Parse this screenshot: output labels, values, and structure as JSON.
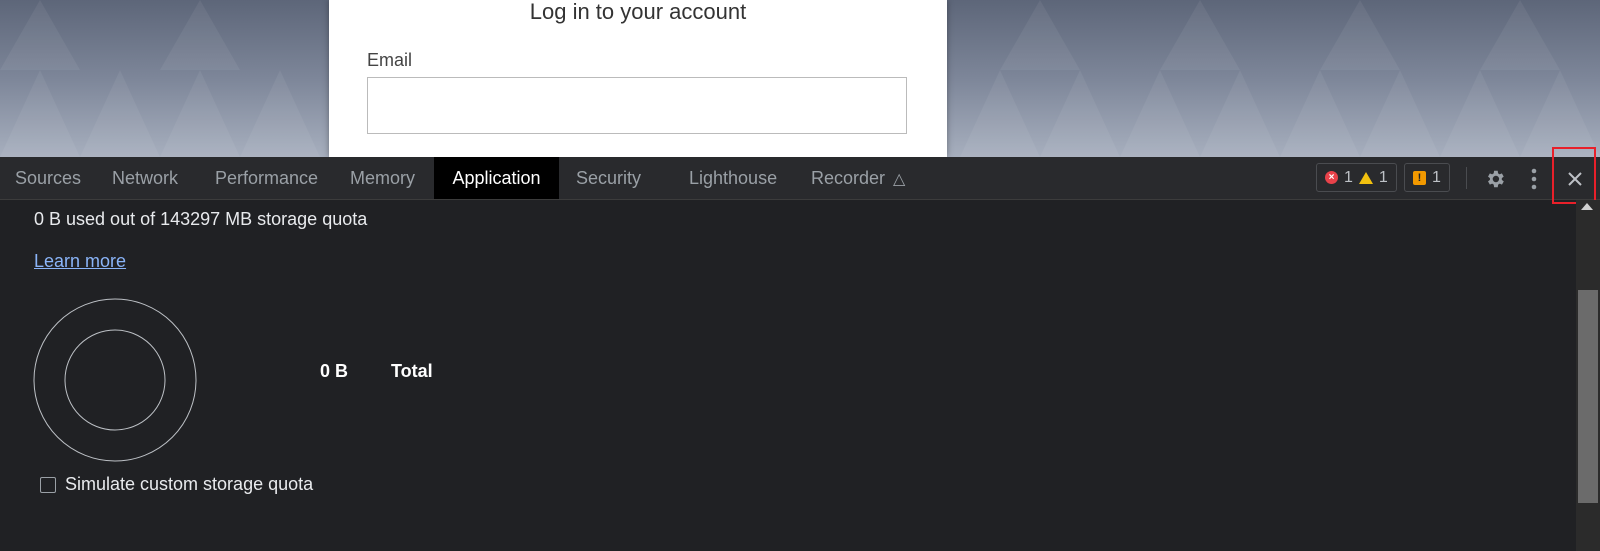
{
  "page": {
    "login_title": "Log in to your account",
    "email_label": "Email",
    "email_value": ""
  },
  "devtools": {
    "tabs": [
      {
        "label": "Sources",
        "active": false
      },
      {
        "label": "Network",
        "active": false
      },
      {
        "label": "Performance",
        "active": false
      },
      {
        "label": "Memory",
        "active": false
      },
      {
        "label": "Application",
        "active": true
      },
      {
        "label": "Security",
        "active": false
      },
      {
        "label": "Lighthouse",
        "active": false
      },
      {
        "label": "Recorder",
        "active": false
      }
    ],
    "counters": {
      "errors": "1",
      "warnings": "1",
      "issues": "1"
    },
    "icons": {
      "recorder": "flask-icon",
      "settings": "gear-icon",
      "more": "more-vertical-icon",
      "close": "close-icon"
    },
    "colors": {
      "error": "#e8424a",
      "warning": "#f2c10f",
      "issue": "#f29900",
      "link": "#8ab4f8",
      "highlight": "#e8202a"
    }
  },
  "storage": {
    "quota_text": "0 B used out of 143297 MB storage quota",
    "learn_more": "Learn more",
    "total_value": "0 B",
    "total_label": "Total",
    "simulate_label": "Simulate custom storage quota",
    "simulate_checked": false
  }
}
